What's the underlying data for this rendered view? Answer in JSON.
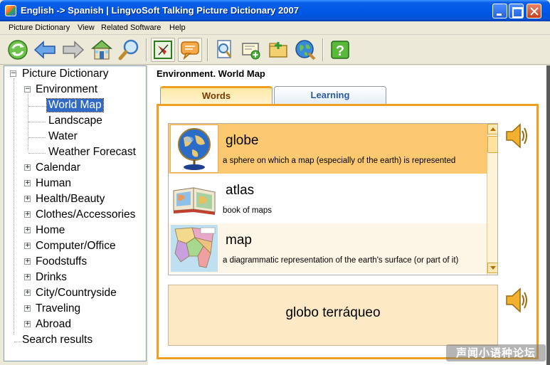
{
  "window": {
    "title": "English -> Spanish  |  LingvoSoft Talking Picture Dictionary 2007"
  },
  "menu": [
    "Picture Dictionary",
    "View",
    "Related Software",
    "Help"
  ],
  "toolbar": {
    "icons": [
      "refresh-icon",
      "back-arrow-icon",
      "forward-arrow-icon",
      "home-icon",
      "search-icon",
      "picture-mode-icon",
      "speech-bubble-icon",
      "zoom-page-icon",
      "add-card-icon",
      "add-folder-icon",
      "web-globe-icon",
      "help-icon"
    ]
  },
  "tree": {
    "root": "Picture Dictionary",
    "environment": "Environment",
    "env_children": [
      "World Map",
      "Landscape",
      "Water",
      "Weather Forecast"
    ],
    "categories": [
      "Calendar",
      "Human",
      "Health/Beauty",
      "Clothes/Accessories",
      "Home",
      "Computer/Office",
      "Foodstuffs",
      "Drinks",
      "City/Countryside",
      "Traveling",
      "Abroad"
    ],
    "search": "Search results",
    "expand_glyph": "+",
    "collapse_glyph": "−"
  },
  "content": {
    "breadcrumb": "Environment. World Map",
    "tabs": [
      "Words",
      "Learning"
    ],
    "words": [
      {
        "title": "globe",
        "definition": "a sphere on which a map (especially of the earth) is represented"
      },
      {
        "title": "atlas",
        "definition": "book of maps"
      },
      {
        "title": "map",
        "definition": "a diagrammatic representation of the earth's surface (or part of it)"
      }
    ],
    "translation": "globo terráqueo"
  },
  "watermark": "声闻小语种论坛",
  "colors": {
    "accent_orange": "#f0a020",
    "selected_row": "#fcc970",
    "tree_selection": "#316ac5",
    "translation_bg": "#fde9c4"
  }
}
